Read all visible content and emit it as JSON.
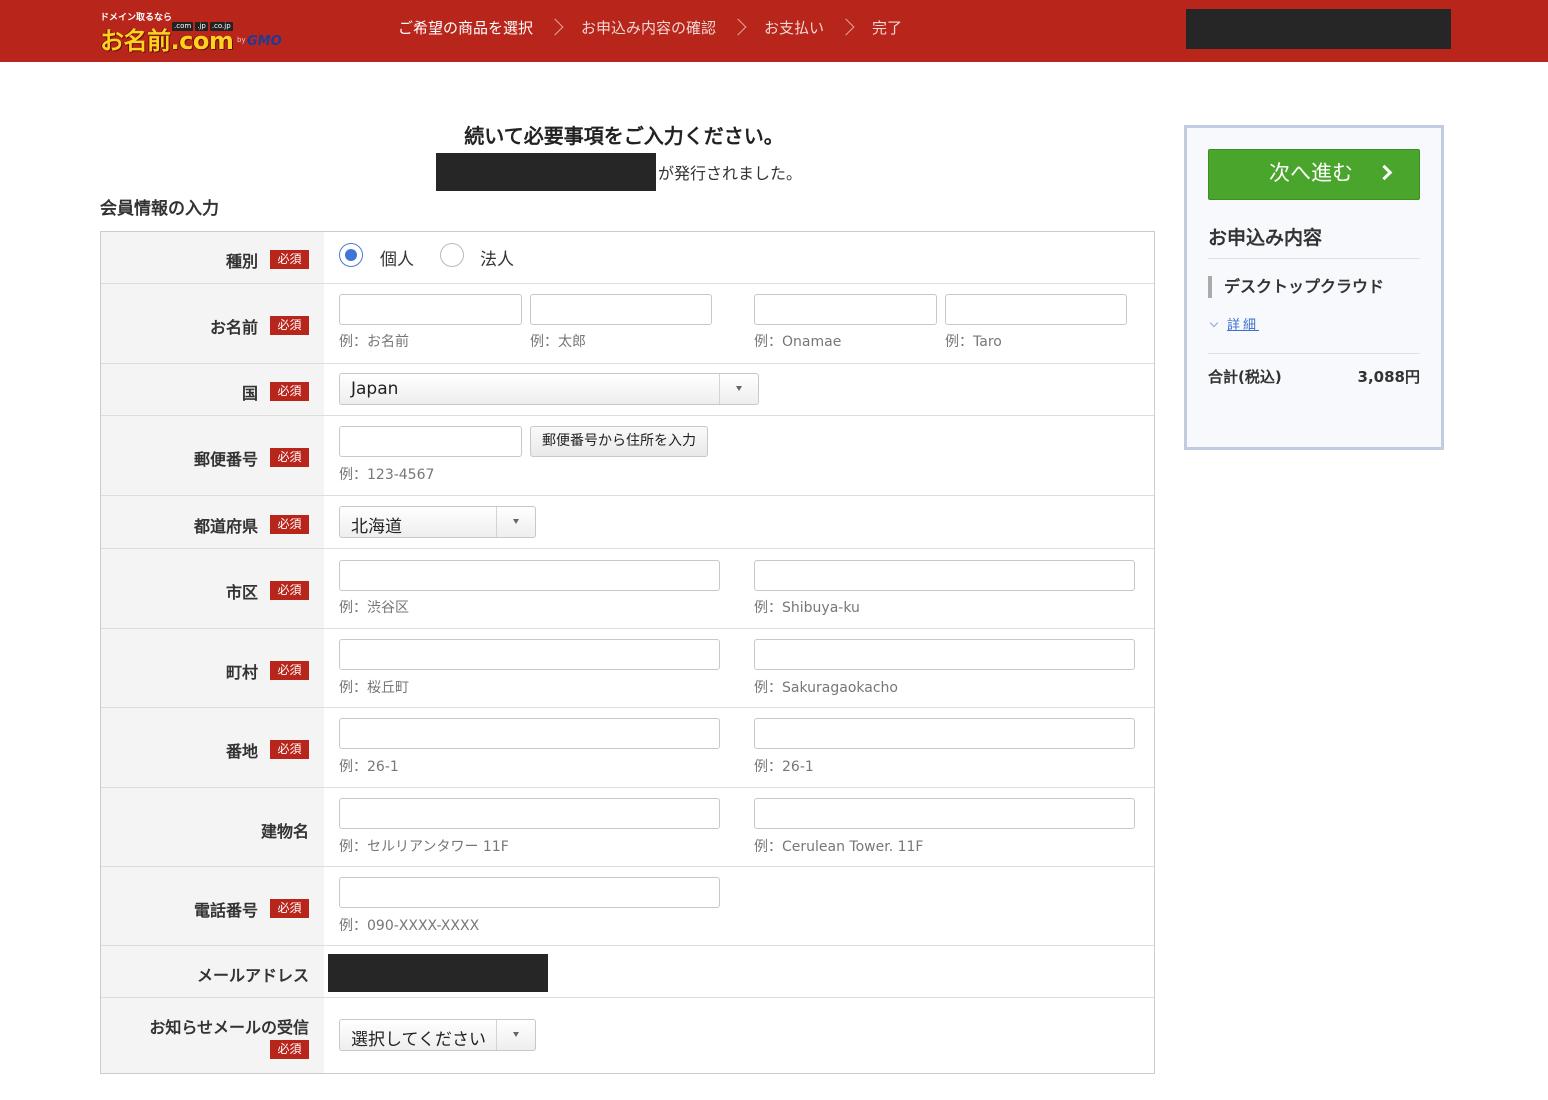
{
  "header": {
    "logo_tagline": "ドメイン取るなら",
    "logo_tlds": [
      ".com",
      ".jp",
      ".co.jp"
    ],
    "logo_main": "お名前.com",
    "logo_by": "by",
    "logo_gmo": "GMO",
    "steps": [
      "ご希望の商品を選択",
      "お申込み内容の確認",
      "お支払い",
      "完了"
    ]
  },
  "main": {
    "title": "続いて必要事項をご入力ください。",
    "issued_suffix": "が発行されました。",
    "section_title": "会員情報の入力"
  },
  "form": {
    "required_badge": "必須",
    "type": {
      "label": "種別",
      "options": [
        "個人",
        "法人"
      ],
      "selected": "個人"
    },
    "name": {
      "label": "お名前",
      "hints": [
        "例：お名前",
        "例：太郎",
        "例：Onamae",
        "例：Taro"
      ]
    },
    "country": {
      "label": "国",
      "value": "Japan"
    },
    "zip": {
      "label": "郵便番号",
      "button": "郵便番号から住所を入力",
      "hint": "例：123-4567"
    },
    "prefecture": {
      "label": "都道府県",
      "value": "北海道"
    },
    "city": {
      "label": "市区",
      "hints": [
        "例：渋谷区",
        "例：Shibuya-ku"
      ]
    },
    "town": {
      "label": "町村",
      "hints": [
        "例：桜丘町",
        "例：Sakuragaokacho"
      ]
    },
    "street": {
      "label": "番地",
      "hints": [
        "例：26-1",
        "例：26-1"
      ]
    },
    "building": {
      "label": "建物名",
      "hints": [
        "例：セルリアンタワー 11F",
        "例：Cerulean Tower. 11F"
      ]
    },
    "phone": {
      "label": "電話番号",
      "hint": "例：090-XXXX-XXXX"
    },
    "email": {
      "label": "メールアドレス"
    },
    "newsletter": {
      "label": "お知らせメールの受信",
      "value": "選択してください"
    }
  },
  "sidebar": {
    "next_button": "次へ進む",
    "title": "お申込み内容",
    "product": "デスクトップクラウド",
    "detail_link": "詳細",
    "total_label": "合計(税込)",
    "total_value": "3,088円"
  },
  "colors": {
    "header_bg": "#b7251b",
    "required_badge": "#b7251b",
    "next_button": "#4aa52c",
    "link": "#3b6fd0",
    "radio_checked": "#3f74d8"
  },
  "icons": [
    "chevron-right-icon",
    "chevron-down-icon",
    "dropdown-arrow-icon",
    "radio-icon"
  ]
}
